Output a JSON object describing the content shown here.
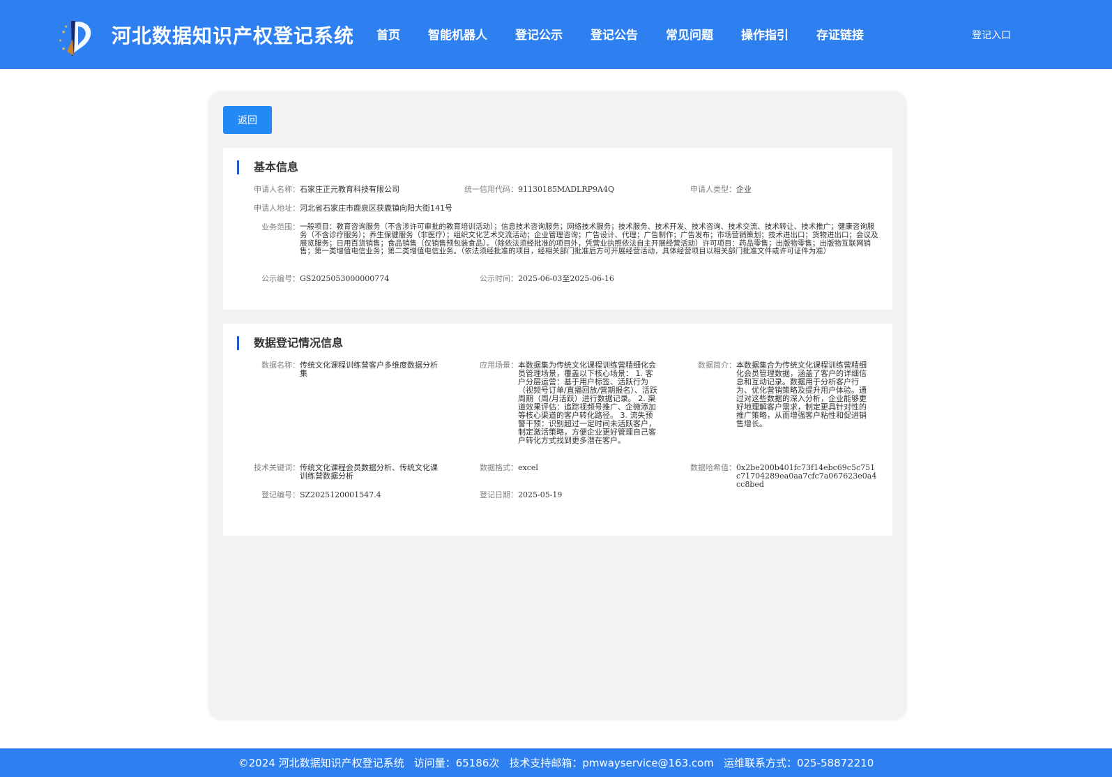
{
  "header": {
    "site_title": "河北数据知识产权登记系统",
    "nav": [
      "首页",
      "智能机器人",
      "登记公示",
      "登记公告",
      "常见问题",
      "操作指引",
      "存证链接"
    ],
    "login": "登记入口"
  },
  "back_button": "返回",
  "basic_info": {
    "title": "基本信息",
    "applicant_name_label": "申请人名称：",
    "applicant_name": "石家庄正元教育科技有限公司",
    "credit_code_label": "统一信用代码：",
    "credit_code": "91130185MADLRP9A4Q",
    "applicant_type_label": "申请人类型：",
    "applicant_type": "企业",
    "address_label": "申请人地址：",
    "address": "河北省石家庄市鹿泉区获鹿镇向阳大街141号",
    "scope_label": "业务范围：",
    "scope": "一般项目：教育咨询服务（不含涉许可审批的教育培训活动）；信息技术咨询服务；网络技术服务；技术服务、技术开发、技术咨询、技术交流、技术转让、技术推广；健康咨询服务（不含诊疗服务）；养生保健服务（非医疗）；组织文化艺术交流活动；企业管理咨询；广告设计、代理；广告制作；广告发布；市场营销策划；技术进出口；货物进出口；会议及展览服务；日用百货销售；食品销售（仅销售预包装食品）。（除依法须经批准的项目外，凭营业执照依法自主开展经营活动）许可项目：药品零售；出版物零售；出版物互联网销售；第一类增值电信业务；第二类增值电信业务。（依法须经批准的项目，经相关部门批准后方可开展经营活动，具体经营项目以相关部门批准文件或许可证件为准）",
    "notice_no_label": "公示编号：",
    "notice_no": "GS2025053000000774",
    "notice_time_label": "公示时间：",
    "notice_time": "2025-06-03至2025-06-16"
  },
  "data_info": {
    "title": "数据登记情况信息",
    "data_name_label": "数据名称：",
    "data_name": "传统文化课程训练营客户多维度数据分析集",
    "scenario_label": "应用场景：",
    "scenario": "本数据集为传统文化课程训练营精细化会员管理场景，覆盖以下核心场景： 1. 客户分层运营：基于用户标签、活跃行为（视频号订单/直播回放/营期报名）、活跃周期（周/月活跃）进行数据记录。 2. 渠道效果评估：追踪视频号推广、企微添加等核心渠道的客户转化路径。 3. 流失预警干预：识别超过一定时间未活跃客户，制定激活策略，方便企业更好管理自己客户转化方式找到更多潜在客户。",
    "summary_label": "数据简介：",
    "summary": "本数据集合为传统文化课程训练营精细化会员管理数据，涵盖了客户的详细信息和互动记录。数据用于分析客户行为、优化营销策略及提升用户体验。通过对这些数据的深入分析，企业能够更好地理解客户需求，制定更具针对性的推广策略，从而增强客户粘性和促进销售增长。",
    "keywords_label": "技术关键词：",
    "keywords": "传统文化课程会员数据分析、传统文化课训练营数据分析",
    "format_label": "数据格式：",
    "format": "excel",
    "hash_label": "数据哈希值：",
    "hash": "0x2be200b401fc73f14ebc69c5c751c71704289ea0aa7cfc7a067623e0a4cc8bed",
    "reg_no_label": "登记编号：",
    "reg_no": "SZ2025120001547.4",
    "reg_date_label": "登记日期：",
    "reg_date": "2025-05-19"
  },
  "footer": {
    "copyright": "©2024 河北数据知识产权登记系统",
    "visits": "访问量：65186次",
    "email": "技术支持邮箱：pmwayservice@163.com",
    "contact": "运维联系方式：025-58872210"
  },
  "colors": {
    "header_bg": "#2e80f0",
    "button_bg": "#2389f4",
    "title_bar": "#1e5cc8"
  }
}
